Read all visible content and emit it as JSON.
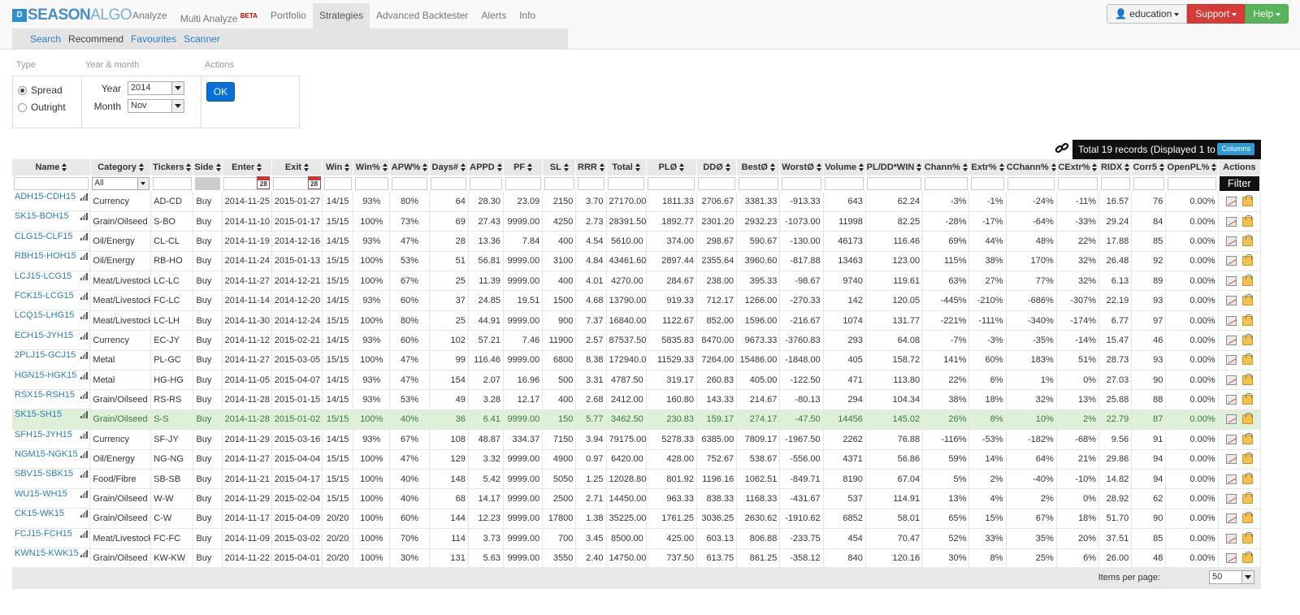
{
  "brand": {
    "mark": "D",
    "name_a": "SEASON",
    "name_b": "ALGO"
  },
  "nav": [
    {
      "label": "Analyze"
    },
    {
      "label": "Multi Analyze",
      "badge": "BETA"
    },
    {
      "label": "Portfolio"
    },
    {
      "label": "Strategies",
      "active": true
    },
    {
      "label": "Advanced Backtester"
    },
    {
      "label": "Alerts"
    },
    {
      "label": "Info"
    }
  ],
  "subnav": [
    {
      "label": "Search"
    },
    {
      "label": "Recommend",
      "active": true
    },
    {
      "label": "Favourites"
    },
    {
      "label": "Scanner"
    }
  ],
  "user_menu": {
    "user": "education",
    "support": "Support",
    "help": "Help"
  },
  "form": {
    "type_header": "Type",
    "year_month_header": "Year & month",
    "actions_header": "Actions",
    "type_options": [
      "Spread",
      "Outright"
    ],
    "type_selected": "Spread",
    "year_label": "Year",
    "year_value": "2014",
    "month_label": "Month",
    "month_value": "Nov",
    "ok_label": "OK"
  },
  "summary": {
    "total_text": "Total 19 records (Displayed 1 to 19)",
    "columns_label": "Columns"
  },
  "table": {
    "columns": [
      "Name",
      "Category",
      "Tickers",
      "Side",
      "Enter",
      "Exit",
      "Win",
      "Win%",
      "APW%",
      "Days#",
      "APPD",
      "PF",
      "SL",
      "RRR",
      "Total",
      "PLØ",
      "DDØ",
      "BestØ",
      "WorstØ",
      "Volume",
      "PL/DD*WIN",
      "Chann%",
      "Extr%",
      "CChann%",
      "CExtr%",
      "RIDX",
      "Corr5",
      "OpenPL%",
      "Actions"
    ],
    "category_filter": "All",
    "calendar_day": "28",
    "filter_label": "Filter",
    "highlight_row": 11,
    "rows": [
      [
        "ADH15-CDH15",
        "Currency",
        "AD-CD",
        "Buy",
        "2014-11-25",
        "2015-01-27",
        "14/15",
        "93%",
        "80%",
        "64",
        "28.30",
        "23.09",
        "2150",
        "3.70",
        "27170.00",
        "1811.33",
        "2706.67",
        "3381.33",
        "-913.33",
        "643",
        "62.24",
        "-3%",
        "-1%",
        "-24%",
        "-11%",
        "16.57",
        "76",
        "0.00%"
      ],
      [
        "SK15-BOH15",
        "Grain/Oilseed",
        "S-BO",
        "Buy",
        "2014-11-10",
        "2015-01-17",
        "15/15",
        "100%",
        "73%",
        "69",
        "27.43",
        "9999.00",
        "4250",
        "2.73",
        "28391.50",
        "1892.77",
        "2301.20",
        "2932.23",
        "-1073.00",
        "11998",
        "82.25",
        "-28%",
        "-17%",
        "-64%",
        "-33%",
        "29.24",
        "84",
        "0.00%"
      ],
      [
        "CLG15-CLF15",
        "Oil/Energy",
        "CL-CL",
        "Buy",
        "2014-11-19",
        "2014-12-16",
        "14/15",
        "93%",
        "47%",
        "28",
        "13.36",
        "7.84",
        "400",
        "4.54",
        "5610.00",
        "374.00",
        "298.67",
        "590.67",
        "-130.00",
        "46173",
        "116.46",
        "69%",
        "44%",
        "48%",
        "22%",
        "17.88",
        "85",
        "0.00%"
      ],
      [
        "RBH15-HOH15",
        "Oil/Energy",
        "RB-HO",
        "Buy",
        "2014-11-24",
        "2015-01-13",
        "15/15",
        "100%",
        "53%",
        "51",
        "56.81",
        "9999.00",
        "3100",
        "4.84",
        "43461.60",
        "2897.44",
        "2355.64",
        "3960.60",
        "-817.88",
        "13463",
        "123.00",
        "115%",
        "38%",
        "170%",
        "32%",
        "26.48",
        "92",
        "0.00%"
      ],
      [
        "LCJ15-LCG15",
        "Meat/Livestock",
        "LC-LC",
        "Buy",
        "2014-11-27",
        "2014-12-21",
        "15/15",
        "100%",
        "67%",
        "25",
        "11.39",
        "9999.00",
        "400",
        "4.01",
        "4270.00",
        "284.67",
        "238.00",
        "395.33",
        "-98.67",
        "9740",
        "119.61",
        "63%",
        "27%",
        "77%",
        "32%",
        "6.13",
        "89",
        "0.00%"
      ],
      [
        "FCK15-LCG15",
        "Meat/Livestock",
        "FC-LC",
        "Buy",
        "2014-11-14",
        "2014-12-20",
        "14/15",
        "93%",
        "60%",
        "37",
        "24.85",
        "19.51",
        "1500",
        "4.68",
        "13790.00",
        "919.33",
        "712.17",
        "1266.00",
        "-270.33",
        "142",
        "120.05",
        "-445%",
        "-210%",
        "-686%",
        "-307%",
        "22.19",
        "93",
        "0.00%"
      ],
      [
        "LCQ15-LHG15",
        "Meat/Livestock",
        "LC-LH",
        "Buy",
        "2014-11-30",
        "2014-12-24",
        "15/15",
        "100%",
        "80%",
        "25",
        "44.91",
        "9999.00",
        "900",
        "7.37",
        "16840.00",
        "1122.67",
        "852.00",
        "1596.00",
        "-216.67",
        "1074",
        "131.77",
        "-221%",
        "-111%",
        "-340%",
        "-174%",
        "6.77",
        "97",
        "0.00%"
      ],
      [
        "ECH15-JYH15",
        "Currency",
        "EC-JY",
        "Buy",
        "2014-11-12",
        "2015-02-21",
        "14/15",
        "93%",
        "60%",
        "102",
        "57.21",
        "7.46",
        "11900",
        "2.57",
        "87537.50",
        "5835.83",
        "8470.00",
        "9673.33",
        "-3760.83",
        "293",
        "64.08",
        "-7%",
        "-3%",
        "-35%",
        "-14%",
        "15.47",
        "46",
        "0.00%"
      ],
      [
        "2PLJ15-GCJ15",
        "Metal",
        "PL-GC",
        "Buy",
        "2014-11-27",
        "2015-03-05",
        "15/15",
        "100%",
        "47%",
        "99",
        "116.46",
        "9999.00",
        "6800",
        "8.38",
        "172940.00",
        "11529.33",
        "7264.00",
        "15486.00",
        "-1848.00",
        "405",
        "158.72",
        "141%",
        "60%",
        "183%",
        "51%",
        "28.73",
        "93",
        "0.00%"
      ],
      [
        "HGN15-HGK15",
        "Metal",
        "HG-HG",
        "Buy",
        "2014-11-05",
        "2015-04-07",
        "14/15",
        "93%",
        "47%",
        "154",
        "2.07",
        "16.96",
        "500",
        "3.31",
        "4787.50",
        "319.17",
        "260.83",
        "405.00",
        "-122.50",
        "471",
        "113.80",
        "22%",
        "6%",
        "1%",
        "0%",
        "27.03",
        "90",
        "0.00%"
      ],
      [
        "RSX15-RSH15",
        "Grain/Oilseed",
        "RS-RS",
        "Buy",
        "2014-11-28",
        "2015-01-15",
        "14/15",
        "93%",
        "53%",
        "49",
        "3.28",
        "12.17",
        "400",
        "2.68",
        "2412.00",
        "160.80",
        "143.33",
        "214.67",
        "-80.13",
        "294",
        "104.34",
        "38%",
        "18%",
        "32%",
        "13%",
        "25.88",
        "88",
        "0.00%"
      ],
      [
        "SK15-SH15",
        "Grain/Oilseed",
        "S-S",
        "Buy",
        "2014-11-28",
        "2015-01-02",
        "15/15",
        "100%",
        "40%",
        "36",
        "6.41",
        "9999.00",
        "150",
        "5.77",
        "3462.50",
        "230.83",
        "159.17",
        "274.17",
        "-47.50",
        "14456",
        "145.02",
        "26%",
        "8%",
        "10%",
        "2%",
        "22.79",
        "87",
        "0.00%"
      ],
      [
        "SFH15-JYH15",
        "Currency",
        "SF-JY",
        "Buy",
        "2014-11-29",
        "2015-03-16",
        "14/15",
        "93%",
        "67%",
        "108",
        "48.87",
        "334.37",
        "7150",
        "3.94",
        "79175.00",
        "5278.33",
        "6385.00",
        "7809.17",
        "-1967.50",
        "2262",
        "76.88",
        "-116%",
        "-53%",
        "-182%",
        "-68%",
        "9.56",
        "91",
        "0.00%"
      ],
      [
        "NGM15-NGK15",
        "Oil/Energy",
        "NG-NG",
        "Buy",
        "2014-11-27",
        "2015-04-04",
        "15/15",
        "100%",
        "47%",
        "129",
        "3.32",
        "9999.00",
        "4900",
        "0.97",
        "6420.00",
        "428.00",
        "752.67",
        "538.67",
        "-556.00",
        "4371",
        "56.86",
        "59%",
        "14%",
        "64%",
        "21%",
        "29.86",
        "94",
        "0.00%"
      ],
      [
        "SBV15-SBK15",
        "Food/Fibre",
        "SB-SB",
        "Buy",
        "2014-11-21",
        "2015-04-17",
        "15/15",
        "100%",
        "40%",
        "148",
        "5.42",
        "9999.00",
        "5050",
        "1.25",
        "12028.80",
        "801.92",
        "1196.16",
        "1062.51",
        "-849.71",
        "8190",
        "67.04",
        "5%",
        "2%",
        "-40%",
        "-10%",
        "14.82",
        "94",
        "0.00%"
      ],
      [
        "WU15-WH15",
        "Grain/Oilseed",
        "W-W",
        "Buy",
        "2014-11-29",
        "2015-02-04",
        "15/15",
        "100%",
        "40%",
        "68",
        "14.17",
        "9999.00",
        "2500",
        "2.71",
        "14450.00",
        "963.33",
        "838.33",
        "1168.33",
        "-431.67",
        "537",
        "114.91",
        "13%",
        "4%",
        "2%",
        "0%",
        "28.92",
        "62",
        "0.00%"
      ],
      [
        "CK15-WK15",
        "Grain/Oilseed",
        "C-W",
        "Buy",
        "2014-11-17",
        "2015-04-09",
        "20/20",
        "100%",
        "60%",
        "144",
        "12.23",
        "9999.00",
        "17800",
        "1.38",
        "35225.00",
        "1761.25",
        "3036.25",
        "2630.62",
        "-1910.62",
        "6852",
        "58.01",
        "65%",
        "15%",
        "67%",
        "18%",
        "51.70",
        "90",
        "0.00%"
      ],
      [
        "FCJ15-FCH15",
        "Meat/Livestock",
        "FC-FC",
        "Buy",
        "2014-11-09",
        "2015-03-02",
        "20/20",
        "100%",
        "70%",
        "114",
        "3.73",
        "9999.00",
        "700",
        "3.45",
        "8500.00",
        "425.00",
        "603.13",
        "806.88",
        "-233.75",
        "454",
        "70.47",
        "52%",
        "33%",
        "35%",
        "20%",
        "37.51",
        "85",
        "0.00%"
      ],
      [
        "KWN15-KWK15",
        "Grain/Oilseed",
        "KW-KW",
        "Buy",
        "2014-11-22",
        "2015-04-01",
        "20/20",
        "100%",
        "30%",
        "131",
        "5.63",
        "9999.00",
        "3550",
        "2.40",
        "14750.00",
        "737.50",
        "613.75",
        "861.25",
        "-358.12",
        "840",
        "120.16",
        "30%",
        "8%",
        "25%",
        "6%",
        "26.00",
        "48",
        "0.00%"
      ]
    ]
  },
  "footer": {
    "items_per_page_label": "Items per page:",
    "items_per_page_value": "50"
  },
  "colors": {
    "link": "#2a7ec0",
    "highlight_row_bg": "#dff0d8",
    "highlight_row_text": "#3c763d",
    "ok_button": "#0870d8",
    "support_button": "#d83a35",
    "help_button": "#58b35a",
    "columns_button": "#2e9ad6"
  }
}
